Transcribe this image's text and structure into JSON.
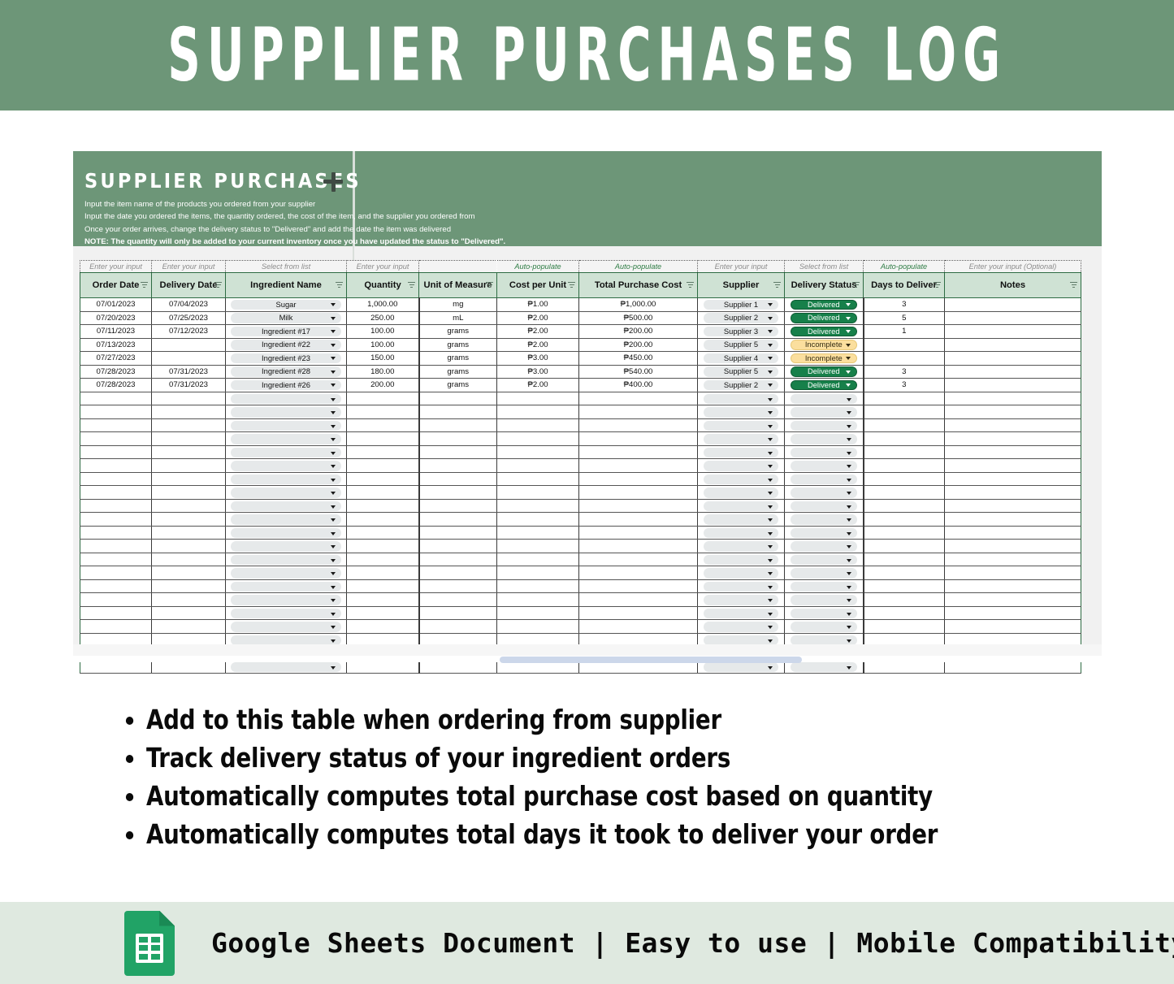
{
  "banner": {
    "title": "SUPPLIER PURCHASES LOG",
    "bg_color": "#6d9678"
  },
  "sheet": {
    "title": "SUPPLIER PURCHASES",
    "plus_icon": "plus-icon",
    "instructions": [
      "Input the item name of the products you ordered from your supplier",
      "Input the date you ordered the items, the quantity ordered, the cost of the item, and the supplier you ordered from",
      "Once your order arrives, change the delivery status to \"Delivered\" and add the date the item was delivered"
    ],
    "note": "NOTE: The quantity will only be added to your current inventory once you have updated the status to \"Delivered\".",
    "header_bg": "#6d9678",
    "table_header_bg": "#cfe2d4"
  },
  "table": {
    "hints": [
      "Enter your input",
      "Enter your input",
      "Select from list",
      "Enter your input",
      "",
      "Auto-populate",
      "Auto-populate",
      "Enter your input",
      "Select from list",
      "Auto-populate",
      "Enter your input (Optional)"
    ],
    "hint_auto_flags": [
      false,
      false,
      false,
      false,
      false,
      true,
      true,
      false,
      false,
      true,
      false
    ],
    "columns": [
      "Order Date",
      "Delivery Date",
      "Ingredient Name",
      "Quantity",
      "Unit of Measure",
      "Cost per Unit",
      "Total Purchase Cost",
      "Supplier",
      "Delivery Status",
      "Days to Deliver",
      "Notes"
    ],
    "rows": [
      {
        "order_date": "07/01/2023",
        "delivery_date": "07/04/2023",
        "ingredient": "Sugar",
        "quantity": "1,000.00",
        "unit": "mg",
        "cost_per_unit": "₱1.00",
        "total_cost": "₱1,000.00",
        "supplier": "Supplier 1",
        "status": "Delivered",
        "status_color": "green",
        "days": "3",
        "notes": ""
      },
      {
        "order_date": "07/20/2023",
        "delivery_date": "07/25/2023",
        "ingredient": "Milk",
        "quantity": "250.00",
        "unit": "mL",
        "cost_per_unit": "₱2.00",
        "total_cost": "₱500.00",
        "supplier": "Supplier 2",
        "status": "Delivered",
        "status_color": "green",
        "days": "5",
        "notes": ""
      },
      {
        "order_date": "07/11/2023",
        "delivery_date": "07/12/2023",
        "ingredient": "Ingredient #17",
        "quantity": "100.00",
        "unit": "grams",
        "cost_per_unit": "₱2.00",
        "total_cost": "₱200.00",
        "supplier": "Supplier 3",
        "status": "Delivered",
        "status_color": "green",
        "days": "1",
        "notes": ""
      },
      {
        "order_date": "07/13/2023",
        "delivery_date": "",
        "ingredient": "Ingredient #22",
        "quantity": "100.00",
        "unit": "grams",
        "cost_per_unit": "₱2.00",
        "total_cost": "₱200.00",
        "supplier": "Supplier 5",
        "status": "Incomplete",
        "status_color": "amber",
        "days": "",
        "notes": ""
      },
      {
        "order_date": "07/27/2023",
        "delivery_date": "",
        "ingredient": "Ingredient #23",
        "quantity": "150.00",
        "unit": "grams",
        "cost_per_unit": "₱3.00",
        "total_cost": "₱450.00",
        "supplier": "Supplier 4",
        "status": "Incomplete",
        "status_color": "amber",
        "days": "",
        "notes": ""
      },
      {
        "order_date": "07/28/2023",
        "delivery_date": "07/31/2023",
        "ingredient": "Ingredient #28",
        "quantity": "180.00",
        "unit": "grams",
        "cost_per_unit": "₱3.00",
        "total_cost": "₱540.00",
        "supplier": "Supplier 5",
        "status": "Delivered",
        "status_color": "green",
        "days": "3",
        "notes": ""
      },
      {
        "order_date": "07/28/2023",
        "delivery_date": "07/31/2023",
        "ingredient": "Ingredient #26",
        "quantity": "200.00",
        "unit": "grams",
        "cost_per_unit": "₱2.00",
        "total_cost": "₱400.00",
        "supplier": "Supplier 2",
        "status": "Delivered",
        "status_color": "green",
        "days": "3",
        "notes": ""
      }
    ],
    "empty_row_count": 21,
    "status_colors": {
      "delivered": "#17804a",
      "incomplete": "#fbdf9e"
    }
  },
  "features": [
    "Add to this table when ordering from supplier",
    "Track delivery status of your ingredient orders",
    "Automatically computes total purchase cost based on quantity",
    "Automatically computes total days it took to deliver your order"
  ],
  "footer": {
    "icon": "google-sheets-icon",
    "text": "Google Sheets Document | Easy to use | Mobile Compatibility",
    "bg_color": "#dfe9e0"
  }
}
